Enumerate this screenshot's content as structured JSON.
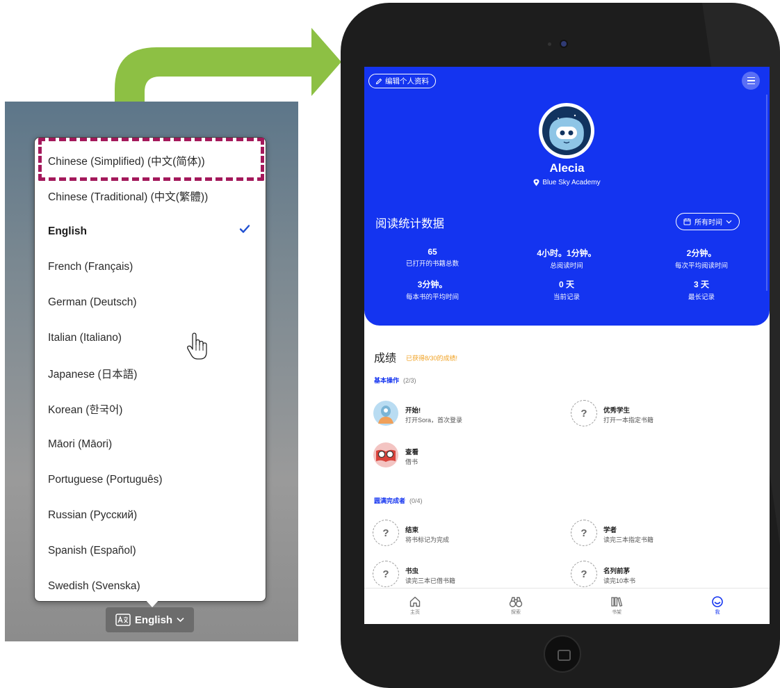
{
  "language_menu": {
    "items": [
      {
        "label": "Chinese (Simplified) (中文(简体))",
        "selected": false
      },
      {
        "label": "Chinese (Traditional) (中文(繁體))",
        "selected": false
      },
      {
        "label": "English",
        "selected": true
      },
      {
        "label": "French (Français)",
        "selected": false
      },
      {
        "label": "German (Deutsch)",
        "selected": false
      },
      {
        "label": "Italian (Italiano)",
        "selected": false
      },
      {
        "label": "Japanese (日本語)",
        "selected": false
      },
      {
        "label": "Korean (한국어)",
        "selected": false
      },
      {
        "label": "Māori (Māori)",
        "selected": false
      },
      {
        "label": "Portuguese (Português)",
        "selected": false
      },
      {
        "label": "Russian (Русский)",
        "selected": false
      },
      {
        "label": "Spanish (Español)",
        "selected": false
      },
      {
        "label": "Swedish (Svenska)",
        "selected": false
      }
    ],
    "toggle_label": "English",
    "toggle_icon": "translate-icon",
    "highlight_color": "#a3195b"
  },
  "arrow": {
    "color": "#8dc044"
  },
  "profile": {
    "edit_label": "编辑个人资料",
    "name": "Alecia",
    "school": "Blue Sky Academy",
    "accent_color": "#1434f0"
  },
  "reading_stats": {
    "title": "阅读统计数据",
    "time_filter": "所有时间",
    "stats": [
      {
        "value": "65",
        "label": "已打开的书籍总数"
      },
      {
        "value": "4小时。1分钟。",
        "label": "总阅读时间"
      },
      {
        "value": "2分钟。",
        "label": "每次平均阅读时间"
      },
      {
        "value": "3分钟。",
        "label": "每本书的平均时间"
      },
      {
        "value": "0 天",
        "label": "当前记录"
      },
      {
        "value": "3 天",
        "label": "最长记录"
      }
    ]
  },
  "achievements": {
    "title": "成绩",
    "count_text": "已获得8/30的成绩!",
    "sections": [
      {
        "name": "基本操作",
        "count": "(2/3)",
        "items": [
          {
            "title": "开始!",
            "desc": "打开Sora，首次登录",
            "earned": true
          },
          {
            "title": "优秀学生",
            "desc": "打开一本指定书籍",
            "earned": false
          },
          {
            "title": "查看",
            "desc": "借书",
            "earned": true
          }
        ]
      },
      {
        "name": "圆满完成者",
        "count": "(0/4)",
        "items": [
          {
            "title": "结束",
            "desc": "将书标记为完成",
            "earned": false
          },
          {
            "title": "学者",
            "desc": "读完三本指定书籍",
            "earned": false
          },
          {
            "title": "书虫",
            "desc": "读完三本已借书籍",
            "earned": false
          },
          {
            "title": "名列前茅",
            "desc": "读完10本书",
            "earned": false
          }
        ]
      }
    ],
    "unknown_symbol": "?"
  },
  "bottom_nav": [
    {
      "label": "主页",
      "icon": "home-icon",
      "active": false
    },
    {
      "label": "探索",
      "icon": "binoculars-icon",
      "active": false
    },
    {
      "label": "书架",
      "icon": "bookshelf-icon",
      "active": false
    },
    {
      "label": "我",
      "icon": "smiley-icon",
      "active": true
    }
  ]
}
